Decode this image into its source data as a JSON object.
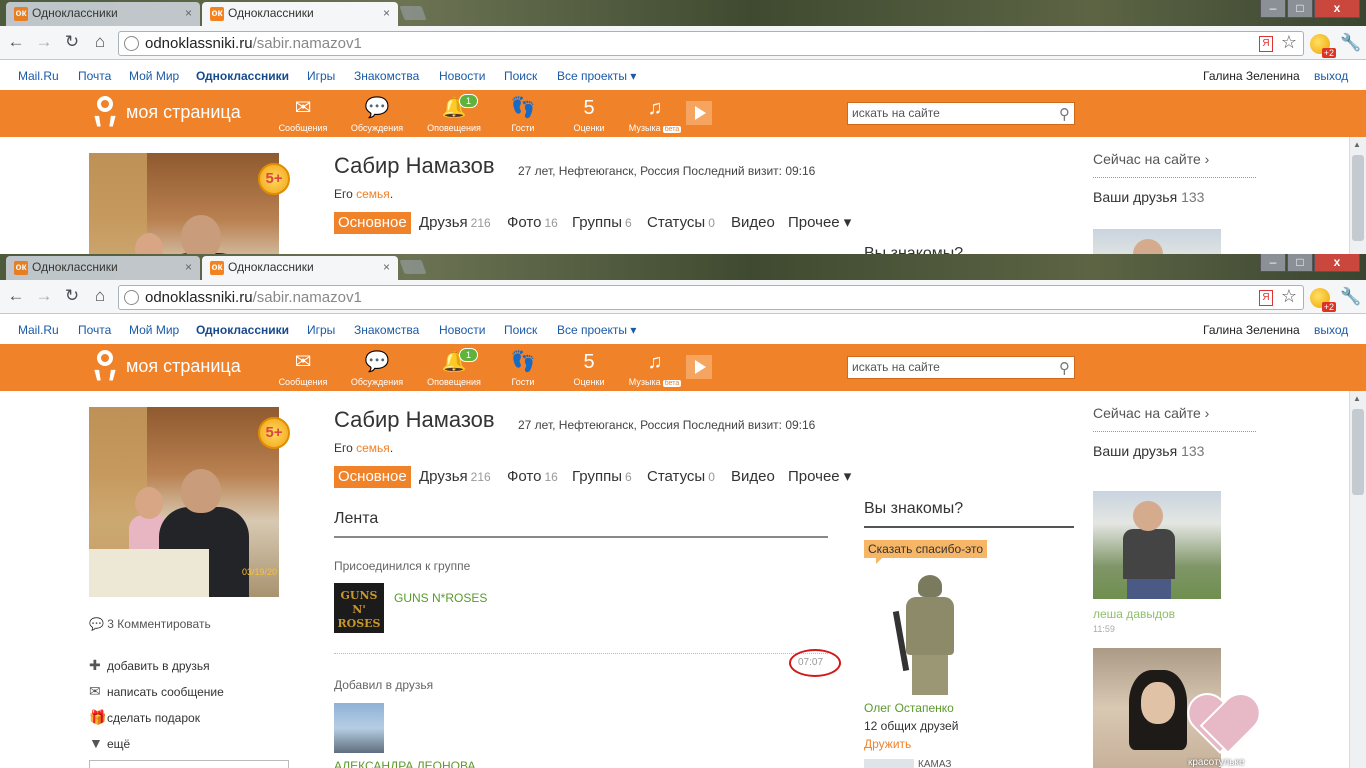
{
  "browser": {
    "tab_inactive": "Одноклассники",
    "tab_active": "Одноклассники",
    "tab_close": "×",
    "url_host": "odnoklassniki.ru",
    "url_path": "/sabir.namazov1",
    "window_min": "–",
    "window_max": "□",
    "window_close": "x",
    "ext_badge": "+2",
    "yandex_icon": "Я"
  },
  "mailbar": {
    "links": [
      "Mail.Ru",
      "Почта",
      "Мой Мир",
      "Одноклассники",
      "Игры",
      "Знакомства",
      "Новости",
      "Поиск",
      "Все проекты ▾"
    ],
    "user": "Галина Зеленина",
    "logout": "выход"
  },
  "orangebar": {
    "mypage": "моя страница",
    "nav": [
      {
        "label": "Сообщения",
        "icon": "envelope-icon"
      },
      {
        "label": "Обсуждения",
        "icon": "chat-icon"
      },
      {
        "label": "Оповещения",
        "icon": "bell-icon",
        "count": "1"
      },
      {
        "label": "Гости",
        "icon": "footprints-icon"
      },
      {
        "label": "Оценки",
        "icon": "rating-icon",
        "glyph": "5"
      },
      {
        "label": "Музыка",
        "icon": "music-icon",
        "beta": "бета"
      }
    ],
    "search_placeholder": "искать на сайте",
    "accent": "#f0822a"
  },
  "profile": {
    "name": "Сабир Намазов",
    "meta": "27 лет, Нефтеюганск, Россия  Последний визит: 09:16",
    "family_prefix": "Его ",
    "family_link": "семья",
    "family_suffix": ".",
    "photo_date": "03/19/20",
    "rating_badge": "5+",
    "comments": "3 Комментировать",
    "actions": [
      "добавить в друзья",
      "написать сообщение",
      "сделать подарок",
      "ещё"
    ],
    "tabs": [
      {
        "label": "Основное",
        "count": ""
      },
      {
        "label": "Друзья",
        "count": "216"
      },
      {
        "label": "Фото",
        "count": "16"
      },
      {
        "label": "Группы",
        "count": "6"
      },
      {
        "label": "Статусы",
        "count": "0"
      },
      {
        "label": "Видео",
        "count": ""
      },
      {
        "label": "Прочее ▾",
        "count": ""
      }
    ]
  },
  "feed": {
    "title": "Лента",
    "item1_title": "Присоединился к группе",
    "item1_thumb": "GUNS N' ROSES",
    "item1_link": "GUNS N*ROSES",
    "item1_time": "07:07",
    "item2_title": "Добавил в друзья",
    "item2_link": "АЛЕКСАНДРА ЛЕОНОВА"
  },
  "know": {
    "title": "Вы знакомы?",
    "title_cut": "Вы знакомы?",
    "thanks": "Сказать спасибо-это",
    "person": "Олег Остапенко",
    "common": "12 общих друзей",
    "befriend": "Дружить",
    "next_stub": "КАМАЗ"
  },
  "right": {
    "online": "Сейчас на сайте ›",
    "friends_label": "Ваши друзья",
    "friends_count": "133",
    "friend1_name": "леша давыдов",
    "friend1_time": "11:59",
    "heart_caption": "красотульке"
  }
}
